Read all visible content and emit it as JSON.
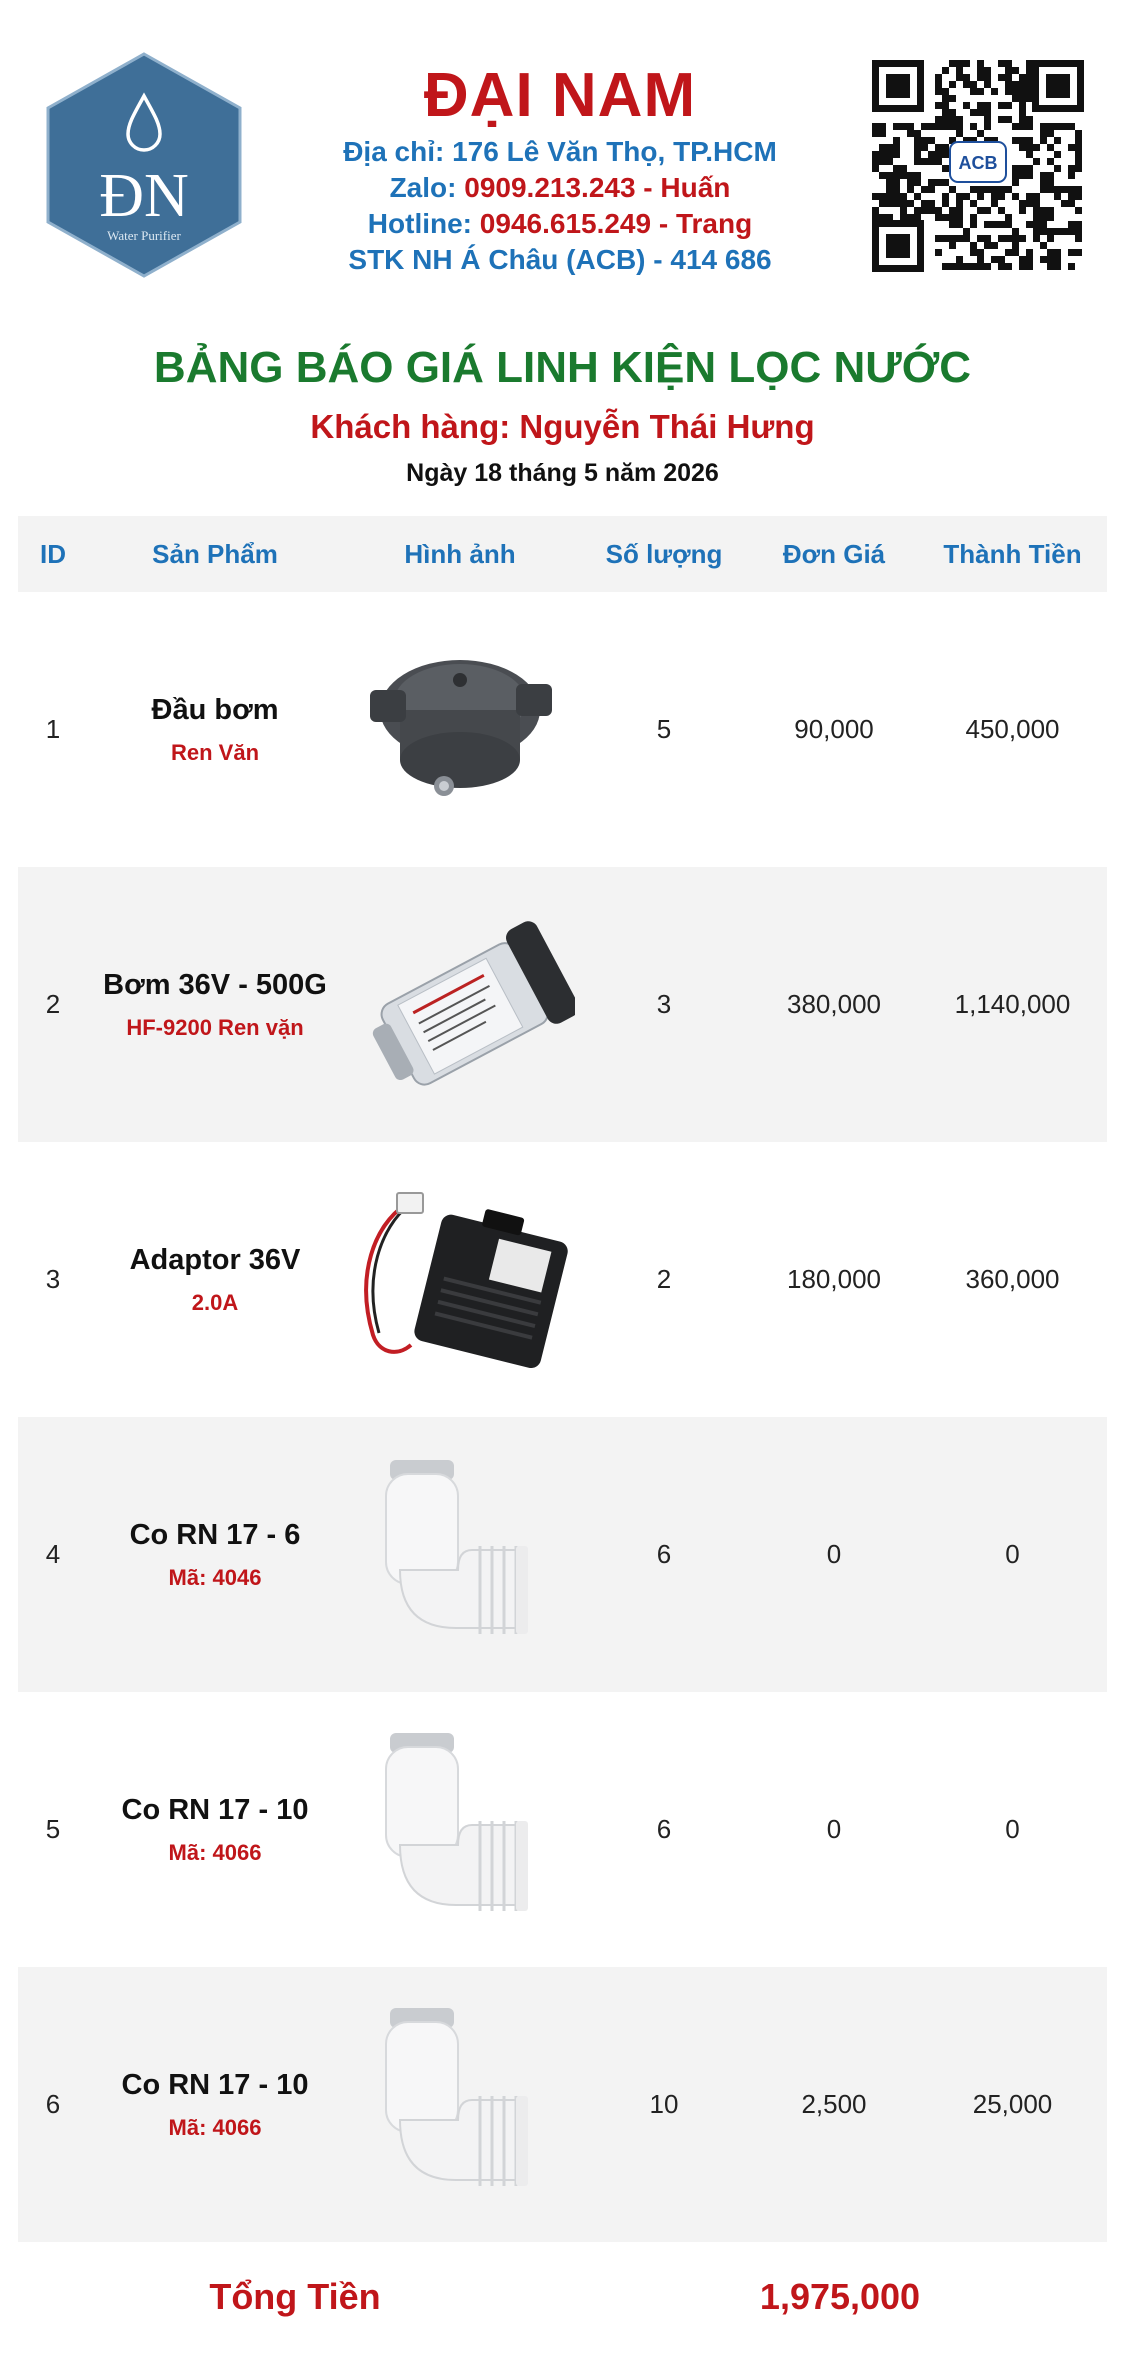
{
  "header": {
    "logo_text": "ĐN",
    "logo_tagline": "Water Purifier",
    "company_name": "ĐẠI NAM",
    "address": "Địa chỉ: 176 Lê Văn Thọ, TP.HCM",
    "zalo_label": "Zalo:",
    "zalo_value": "0909.213.243 - Huấn",
    "hotline_label": "Hotline:",
    "hotline_value": "0946.615.249 - Trang",
    "bank": "STK NH Á Châu (ACB) - 414 686",
    "qr_label": "ACB"
  },
  "title": "BẢNG BÁO GIÁ LINH KIỆN LỌC NƯỚC",
  "customer_label": "Khách hàng:",
  "customer_name": "Nguyễn Thái Hưng",
  "date": "Ngày 18 tháng 5 năm 2026",
  "table": {
    "headers": {
      "id": "ID",
      "product": "Sản Phẩm",
      "image": "Hình ảnh",
      "quantity": "Số lượng",
      "unit_price": "Đơn Giá",
      "amount": "Thành Tiền"
    },
    "rows": [
      {
        "id": "1",
        "name": "Đầu bơm",
        "sub": "Ren Văn",
        "image": "pump-head-icon",
        "qty": "5",
        "price": "90,000",
        "total": "450,000"
      },
      {
        "id": "2",
        "name": "Bơm 36V - 500G",
        "sub": "HF-9200 Ren vặn",
        "image": "pump-icon",
        "qty": "3",
        "price": "380,000",
        "total": "1,140,000"
      },
      {
        "id": "3",
        "name": "Adaptor 36V",
        "sub": "2.0A",
        "image": "adaptor-icon",
        "qty": "2",
        "price": "180,000",
        "total": "360,000"
      },
      {
        "id": "4",
        "name": "Co RN 17 - 6",
        "sub": "Mã: 4046",
        "image": "elbow-fitting-icon",
        "qty": "6",
        "price": "0",
        "total": "0"
      },
      {
        "id": "5",
        "name": "Co RN 17 - 10",
        "sub": "Mã: 4066",
        "image": "elbow-fitting-icon",
        "qty": "6",
        "price": "0",
        "total": "0"
      },
      {
        "id": "6",
        "name": "Co RN 17 - 10",
        "sub": "Mã: 4066",
        "image": "elbow-fitting-icon",
        "qty": "10",
        "price": "2,500",
        "total": "25,000"
      }
    ]
  },
  "total_label": "Tổng Tiền",
  "total_value": "1,975,000",
  "colors": {
    "brand_red": "#c0161a",
    "contact_blue": "#1e72b8",
    "title_green": "#1a7a2e",
    "stripe_gray": "#f3f3f3"
  }
}
